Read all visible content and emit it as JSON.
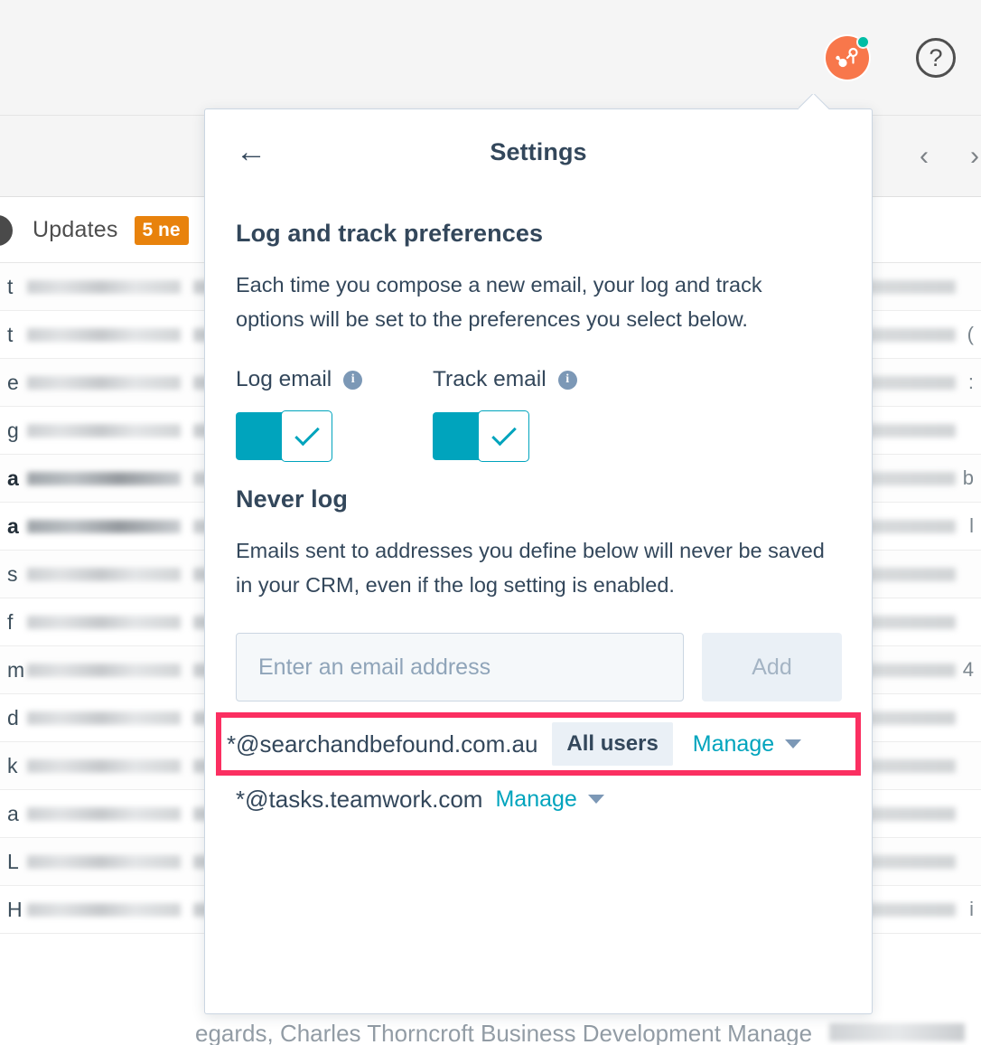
{
  "app": {
    "topbar": {
      "hubspot_logo_icon": "hubspot-sprocket-icon",
      "notification_dot": "green-notification-dot",
      "help_icon": "question-mark-icon",
      "help_label": "?"
    },
    "toolbar": {
      "prev_label": "‹",
      "next_label": "›"
    },
    "updates": {
      "label": "Updates",
      "badge": "5 ne"
    },
    "mail_rows": [
      {
        "start": "t",
        "end": ""
      },
      {
        "start": "t",
        "end": "("
      },
      {
        "start": "e",
        "end": ":"
      },
      {
        "start": "g",
        "end": ""
      },
      {
        "start": "a",
        "end": "b",
        "bold": true
      },
      {
        "start": "a",
        "end": "l",
        "bold": true
      },
      {
        "start": "s",
        "end": ""
      },
      {
        "start": "f",
        "end": ""
      },
      {
        "start": "m",
        "end": "4"
      },
      {
        "start": "d",
        "end": ""
      },
      {
        "start": "k",
        "end": ""
      },
      {
        "start": "a",
        "end": ""
      },
      {
        "start": "L",
        "end": ""
      },
      {
        "start": "H",
        "end": "i"
      }
    ],
    "signature": "egards, Charles Thorncroft Business Development Manage"
  },
  "popover": {
    "back_label": "←",
    "title": "Settings",
    "log_and_track": {
      "heading": "Log and track preferences",
      "description": "Each time you compose a new email, your log and track options will be set to the preferences you select below.",
      "log_email": {
        "label": "Log email",
        "info_glyph": "i",
        "state": "on"
      },
      "track_email": {
        "label": "Track email",
        "info_glyph": "i",
        "state": "on"
      }
    },
    "never_log": {
      "heading": "Never log",
      "description": "Emails sent to addresses you define below will never be saved in your CRM, even if the log setting is enabled.",
      "input_placeholder": "Enter an email address",
      "input_value": "",
      "add_label": "Add",
      "domains": [
        {
          "name": "*@searchandbefound.com.au",
          "scope_badge": "All users",
          "manage_label": "Manage",
          "highlighted": true
        },
        {
          "name": "*@tasks.teamwork.com",
          "scope_badge": "",
          "manage_label": "Manage",
          "highlighted": false
        }
      ]
    }
  },
  "colors": {
    "accent_teal": "#00a4bd",
    "highlight_pink": "#fb2f61",
    "hubspot_orange": "#f8774b",
    "badge_orange": "#e8820c",
    "text_dark": "#33475b",
    "notification_green": "#00bda5"
  }
}
